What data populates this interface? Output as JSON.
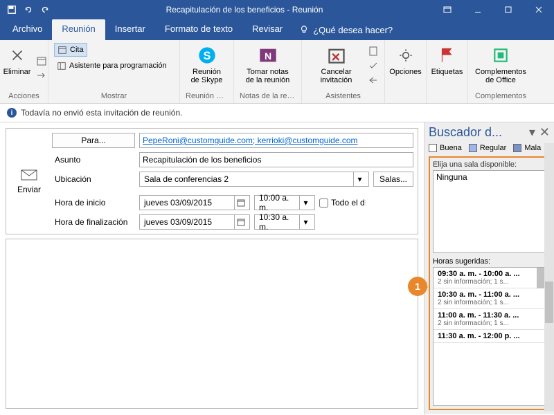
{
  "titlebar": {
    "title": "Recapitulación de los beneficios  -  Reunión"
  },
  "tabs": {
    "file": "Archivo",
    "meeting": "Reunión",
    "insert": "Insertar",
    "format": "Formato de texto",
    "review": "Revisar",
    "tellme": "¿Qué desea hacer?"
  },
  "ribbon": {
    "actions": {
      "delete": "Eliminar",
      "label": "Acciones"
    },
    "show": {
      "cita": "Cita",
      "sched": "Asistente para programación",
      "label": "Mostrar"
    },
    "skype": {
      "btn": "Reunión de Skype",
      "label": "Reunión de..."
    },
    "notes": {
      "btn": "Tomar notas de la reunión",
      "label": "Notas de la reu..."
    },
    "assist": {
      "cancel": "Cancelar invitación",
      "label": "Asistentes"
    },
    "options": {
      "btn": "Opciones"
    },
    "tags": {
      "btn": "Etiquetas"
    },
    "addins": {
      "btn": "Complementos de Office",
      "label": "Complementos"
    }
  },
  "infobar": "Todavía no envió esta invitación de reunión.",
  "form": {
    "send": "Enviar",
    "to_btn": "Para...",
    "to_val": "PepeRoni@customguide.com; kerrioki@customguide.com",
    "subject_lbl": "Asunto",
    "subject_val": "Recapitulación de los beneficios",
    "location_lbl": "Ubicación",
    "location_val": "Sala de conferencias 2",
    "rooms_btn": "Salas...",
    "start_lbl": "Hora de inicio",
    "start_date": "jueves 03/09/2015",
    "start_time": "10:00 a. m.",
    "allday": "Todo el día",
    "end_lbl": "Hora de finalización",
    "end_date": "jueves 03/09/2015",
    "end_time": "10:30 a. m."
  },
  "sidebar": {
    "title": "Buscador d...",
    "legend": {
      "good": "Buena",
      "fair": "Regular",
      "bad": "Mala"
    },
    "room_lbl": "Elija una sala disponible:",
    "room_none": "Ninguna",
    "suggest_lbl": "Horas sugeridas:",
    "suggestions": [
      {
        "time": "09:30 a. m. - 10:00 a. ...",
        "sub": "2 sin información; 1 s..."
      },
      {
        "time": "10:30 a. m. - 11:00 a. ...",
        "sub": "2 sin información; 1 s..."
      },
      {
        "time": "11:00 a. m. - 11:30 a. ...",
        "sub": "2 sin información; 1 s..."
      },
      {
        "time": "11:30 a. m. - 12:00 p. ...",
        "sub": ""
      }
    ]
  },
  "callout": "1"
}
